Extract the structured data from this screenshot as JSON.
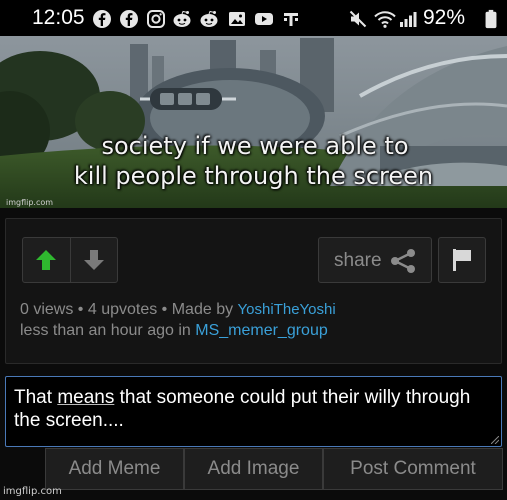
{
  "status_bar": {
    "time": "12:05",
    "battery": "92%",
    "icons": [
      "facebook-icon",
      "facebook-icon",
      "instagram-icon",
      "reddit-icon",
      "reddit-icon",
      "gallery-icon",
      "youtube-icon",
      "t-mobile-icon",
      "mute-icon",
      "wifi-icon",
      "signal-icon"
    ]
  },
  "meme": {
    "caption_line1": "society if we were able to",
    "caption_line2": "kill people through the screen",
    "watermark": "imgflip.com"
  },
  "post": {
    "upvote_color": "#2fb82f",
    "share_label": "share",
    "stats": "0 views • 4 upvotes • Made by",
    "author": "YoshiTheYoshi",
    "time_prefix": "less than an hour ago in",
    "stream": "MS_memer_group",
    "link_color": "#3aa0d8"
  },
  "comment": {
    "before": "That ",
    "underlined": "means",
    "after": " that someone could put their willy through the screen...."
  },
  "actions": {
    "add_meme": "Add Meme",
    "add_image": "Add Image",
    "post_comment": "Post Comment"
  },
  "footer_watermark": "imgflip.com"
}
